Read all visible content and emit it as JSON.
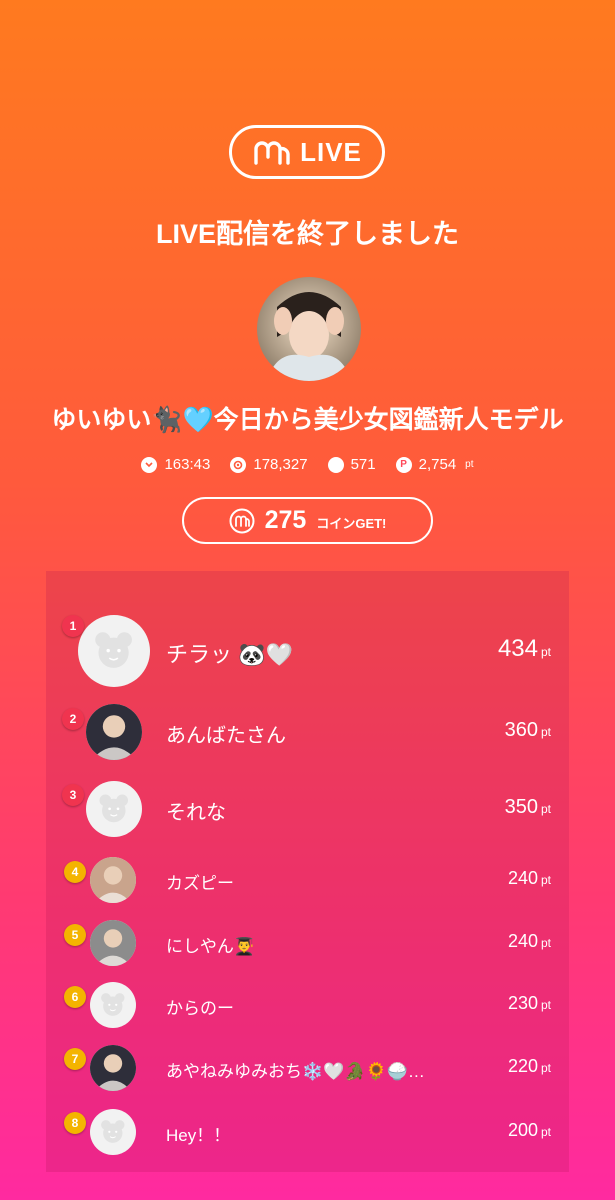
{
  "brand": {
    "logo_text": "LIVE"
  },
  "end_title": "LIVE配信を終了しました",
  "streamer": {
    "name": "ゆいゆい🐈‍⬛🩵今日から美少女図鑑新人モデル"
  },
  "stats": {
    "duration": "163:43",
    "viewers": "178,327",
    "comments": "571",
    "points": "2,754",
    "points_unit": "pt"
  },
  "coins": {
    "amount": "275",
    "label": "コインGET!"
  },
  "ranking": [
    {
      "rank": "1",
      "name": "チラッ 🐼🤍",
      "points": "434",
      "unit": "pt",
      "badge_color": "#f0344f",
      "avatar": "default"
    },
    {
      "rank": "2",
      "name": "あんばたさん",
      "points": "360",
      "unit": "pt",
      "badge_color": "#f0344f",
      "avatar": "photo"
    },
    {
      "rank": "3",
      "name": "それな",
      "points": "350",
      "unit": "pt",
      "badge_color": "#f0344f",
      "avatar": "default"
    },
    {
      "rank": "4",
      "name": "カズピー",
      "points": "240",
      "unit": "pt",
      "badge_color": "#f4b400",
      "avatar": "photo"
    },
    {
      "rank": "5",
      "name": "にしやん👨‍🎓",
      "points": "240",
      "unit": "pt",
      "badge_color": "#f4b400",
      "avatar": "photo"
    },
    {
      "rank": "6",
      "name": "からのー",
      "points": "230",
      "unit": "pt",
      "badge_color": "#f4b400",
      "avatar": "default"
    },
    {
      "rank": "7",
      "name": "あやねみゆみおち❄️🤍🐊🌻🍚…",
      "points": "220",
      "unit": "pt",
      "badge_color": "#f4b400",
      "avatar": "photo"
    },
    {
      "rank": "8",
      "name": "Hey！！",
      "points": "200",
      "unit": "pt",
      "badge_color": "#f4b400",
      "avatar": "default"
    }
  ],
  "colors": {
    "gradient_top": "#ff7a1f",
    "gradient_bottom": "#ff2aa0",
    "text": "#ffffff"
  }
}
